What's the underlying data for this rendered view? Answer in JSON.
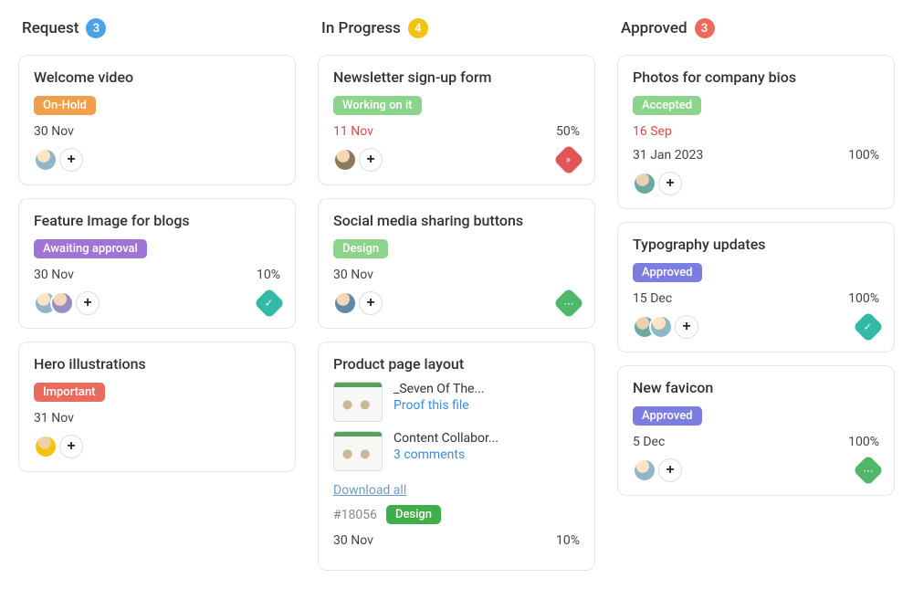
{
  "columns": [
    {
      "title": "Request",
      "count": "3",
      "count_color": "blue",
      "cards": [
        {
          "title": "Welcome video",
          "tag": {
            "text": "On-Hold",
            "color": "orange"
          },
          "date": "30 Nov",
          "avatars": [
            "av1"
          ]
        },
        {
          "title": "Feature Image for blogs",
          "tag": {
            "text": "Awaiting approval",
            "color": "purple"
          },
          "date": "30 Nov",
          "percent": "10%",
          "avatars": [
            "av1",
            "av2"
          ],
          "priority": "teal"
        },
        {
          "title": "Hero illustrations",
          "tag": {
            "text": "Important",
            "color": "red"
          },
          "date": "31 Nov",
          "avatars": [
            "av3"
          ]
        }
      ]
    },
    {
      "title": "In Progress",
      "count": "4",
      "count_color": "yellow",
      "cards": [
        {
          "title": "Newsletter sign-up form",
          "tag": {
            "text": "Working on it",
            "color": "green-light"
          },
          "date": "11 Nov",
          "date_red": true,
          "percent": "50%",
          "avatars": [
            "av4"
          ],
          "priority": "red",
          "priority_glyph": "»"
        },
        {
          "title": "Social media sharing buttons",
          "tag": {
            "text": "Design",
            "color": "green-light"
          },
          "date": "30 Nov",
          "avatars": [
            "av5"
          ],
          "priority": "green",
          "priority_glyph": "⋯"
        },
        {
          "title": "Product page layout",
          "attachments": [
            {
              "name": "_Seven Of The...",
              "action": "Proof this file"
            },
            {
              "name": "Content Collabor...",
              "action": "3 comments"
            }
          ],
          "download_all": "Download all",
          "task_id": "#18056",
          "tag": {
            "text": "Design",
            "color": "green"
          },
          "date": "30 Nov",
          "percent": "10%"
        }
      ]
    },
    {
      "title": "Approved",
      "count": "3",
      "count_color": "red",
      "cards": [
        {
          "title": "Photos for company bios",
          "tag": {
            "text": "Accepted",
            "color": "green-light"
          },
          "date": "16 Sep",
          "date_red": true,
          "date2": "31 Jan 2023",
          "percent": "100%",
          "avatars": [
            "av6"
          ]
        },
        {
          "title": "Typography updates",
          "tag": {
            "text": "Approved",
            "color": "indigo"
          },
          "date": "15 Dec",
          "percent": "100%",
          "avatars": [
            "av6",
            "av1"
          ],
          "priority": "teal"
        },
        {
          "title": "New favicon",
          "tag": {
            "text": "Approved",
            "color": "indigo"
          },
          "date": "5 Dec",
          "percent": "100%",
          "avatars": [
            "av1"
          ],
          "priority": "green",
          "priority_glyph": "⋯"
        }
      ]
    }
  ]
}
